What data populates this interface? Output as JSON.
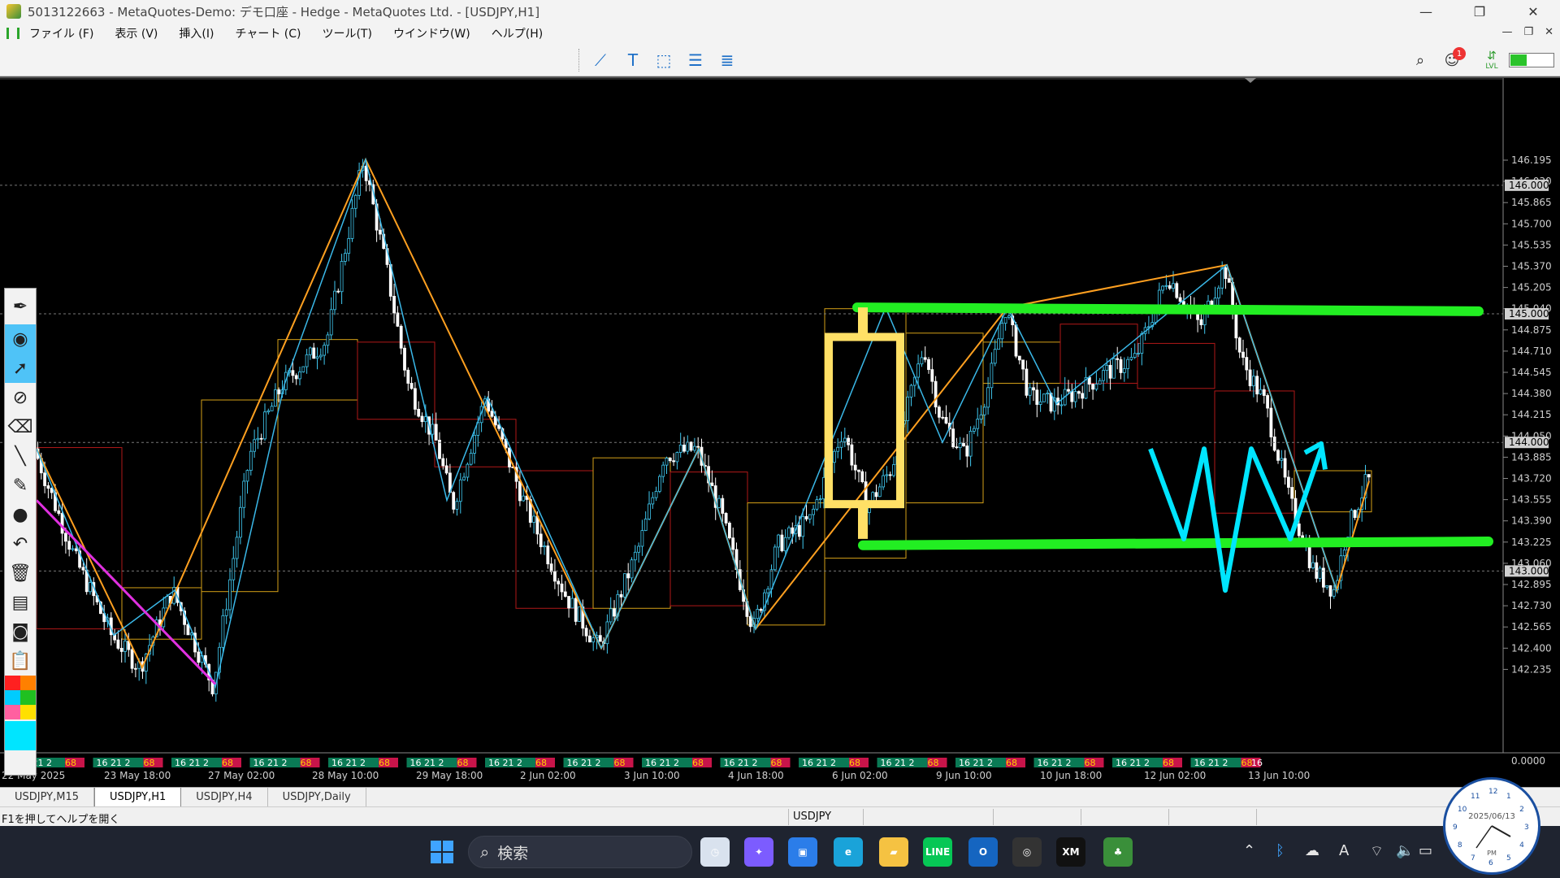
{
  "window": {
    "title": "5013122663 - MetaQuotes-Demo: デモ口座 - Hedge - MetaQuotes Ltd. - [USDJPY,H1]",
    "controls": [
      "—",
      "❐",
      "✕"
    ]
  },
  "menu": {
    "items": [
      "ファイル (F)",
      "表示 (V)",
      "挿入(I)",
      "チャート (C)",
      "ツール(T)",
      "ウインドウ(W)",
      "ヘルプ(H)"
    ],
    "child_controls": [
      "—",
      "❐",
      "✕"
    ]
  },
  "toolbar": {
    "tools": [
      {
        "icon": "trend-line-icon",
        "glyph": "⟋"
      },
      {
        "icon": "text-tool-icon",
        "glyph": "T"
      },
      {
        "icon": "rectangle-tool-icon",
        "glyph": "⬚"
      },
      {
        "icon": "fibonacci-fan-icon",
        "glyph": "☰"
      },
      {
        "icon": "fibonacci-retracement-icon",
        "glyph": "≣"
      }
    ],
    "notification_count": "1",
    "lvl_label": "LVL"
  },
  "chart": {
    "symbol": "USDJPY",
    "timeframe": "H1",
    "background": "#000000",
    "bull_color": "#40c8f0",
    "bear_color": "#ffffff",
    "price_scale": [
      "146.195",
      "146.030",
      "145.865",
      "145.700",
      "145.535",
      "145.370",
      "145.205",
      "145.040",
      "144.875",
      "144.710",
      "144.545",
      "144.380",
      "144.215",
      "144.050",
      "143.885",
      "143.720",
      "143.555",
      "143.390",
      "143.225",
      "143.060",
      "142.895",
      "142.730",
      "142.565",
      "142.400",
      "142.235"
    ],
    "level_tags": [
      "146.000",
      "145.000",
      "144.000",
      "143.000"
    ],
    "subwindow_value": "0.0000",
    "time_axis": [
      "22 May 2025",
      "23 May 18:00",
      "27 May 02:00",
      "28 May 10:00",
      "29 May 18:00",
      "2 Jun 02:00",
      "3 Jun 10:00",
      "4 Jun 18:00",
      "6 Jun 02:00",
      "9 Jun 10:00",
      "10 Jun 18:00",
      "12 Jun 02:00",
      "13 Jun 10:00"
    ],
    "session_label_text": "16 21 2",
    "session_mark_text": "68",
    "last_session_label": "16",
    "annotation_colors": {
      "support_resistance": "#22ee22",
      "zigzag_major": "#ffa020",
      "zigzag_minor": "#3ab8e8",
      "highlight_candle": "#ffe066",
      "forecast_path": "#00e5ff",
      "downtrend_line": "#e030e0",
      "htf_bull_box": "#d4a017",
      "htf_bear_box": "#b01818"
    }
  },
  "left_panel": {
    "tools": [
      {
        "name": "pen-icon",
        "glyph": "✒"
      },
      {
        "name": "eye-icon",
        "glyph": "◉"
      },
      {
        "name": "cursor-icon",
        "glyph": "➚"
      },
      {
        "name": "lasso-icon",
        "glyph": "⊘"
      },
      {
        "name": "eraser-icon",
        "glyph": "⌫"
      },
      {
        "name": "line-icon",
        "glyph": "╲"
      },
      {
        "name": "marker-icon",
        "glyph": "✎"
      },
      {
        "name": "dot-icon",
        "glyph": "●"
      },
      {
        "name": "undo-icon",
        "glyph": "↶"
      },
      {
        "name": "trash-icon",
        "glyph": "🗑"
      },
      {
        "name": "board-icon",
        "glyph": "▤"
      },
      {
        "name": "camera-icon",
        "glyph": "◙"
      },
      {
        "name": "clipboard-icon",
        "glyph": "📋"
      }
    ],
    "palette": [
      "#ff2020",
      "#ff8000",
      "#00ccff",
      "#20c020",
      "#ff60a0",
      "#ffe000"
    ]
  },
  "tabs": {
    "items": [
      "USDJPY,M15",
      "USDJPY,H1",
      "USDJPY,H4",
      "USDJPY,Daily"
    ],
    "active_index": 1
  },
  "status": {
    "help_text": "F1を押してヘルプを開く",
    "symbol": "USDJPY"
  },
  "taskbar": {
    "search_placeholder": "検索",
    "apps": [
      {
        "name": "clock-app-icon",
        "color": "#d9e2ee",
        "glyph": "◷"
      },
      {
        "name": "copilot-icon",
        "color": "#7c5cff",
        "glyph": "✦"
      },
      {
        "name": "store-icon",
        "color": "#2b7de9",
        "glyph": "▣"
      },
      {
        "name": "edge-icon",
        "color": "#1aa3d9",
        "glyph": "e"
      },
      {
        "name": "file-explorer-icon",
        "color": "#f5c242",
        "glyph": "▰"
      },
      {
        "name": "line-app-icon",
        "color": "#06c755",
        "glyph": "LINE"
      },
      {
        "name": "outlook-icon",
        "color": "#1565c0",
        "glyph": "O"
      },
      {
        "name": "vpn-app-icon",
        "color": "#333",
        "glyph": "◎"
      },
      {
        "name": "xm-app-icon",
        "color": "#111",
        "glyph": "XM"
      },
      {
        "name": "metatrader-icon",
        "color": "#3a8f3a",
        "glyph": "♣"
      }
    ]
  },
  "clock": {
    "date": "2025/06/13",
    "ampm": "PM"
  }
}
